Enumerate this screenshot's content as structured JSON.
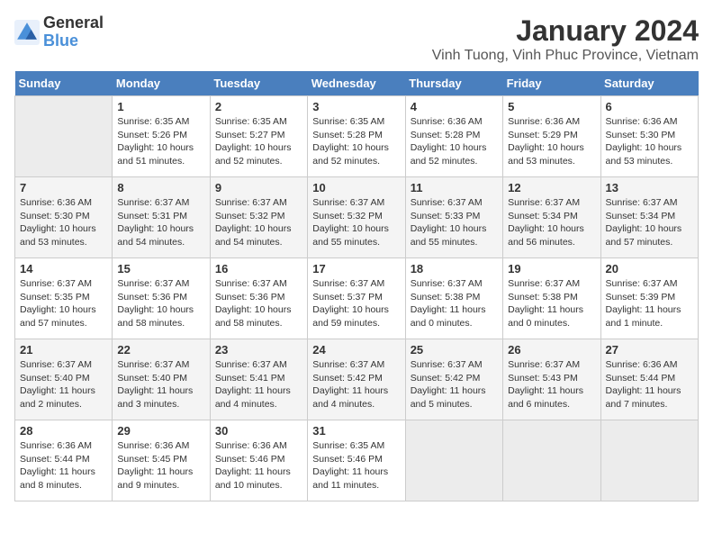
{
  "logo": {
    "text_general": "General",
    "text_blue": "Blue"
  },
  "title": "January 2024",
  "subtitle": "Vinh Tuong, Vinh Phuc Province, Vietnam",
  "header_days": [
    "Sunday",
    "Monday",
    "Tuesday",
    "Wednesday",
    "Thursday",
    "Friday",
    "Saturday"
  ],
  "weeks": [
    [
      {
        "day": "",
        "sunrise": "",
        "sunset": "",
        "daylight": ""
      },
      {
        "day": "1",
        "sunrise": "Sunrise: 6:35 AM",
        "sunset": "Sunset: 5:26 PM",
        "daylight": "Daylight: 10 hours and 51 minutes."
      },
      {
        "day": "2",
        "sunrise": "Sunrise: 6:35 AM",
        "sunset": "Sunset: 5:27 PM",
        "daylight": "Daylight: 10 hours and 52 minutes."
      },
      {
        "day": "3",
        "sunrise": "Sunrise: 6:35 AM",
        "sunset": "Sunset: 5:28 PM",
        "daylight": "Daylight: 10 hours and 52 minutes."
      },
      {
        "day": "4",
        "sunrise": "Sunrise: 6:36 AM",
        "sunset": "Sunset: 5:28 PM",
        "daylight": "Daylight: 10 hours and 52 minutes."
      },
      {
        "day": "5",
        "sunrise": "Sunrise: 6:36 AM",
        "sunset": "Sunset: 5:29 PM",
        "daylight": "Daylight: 10 hours and 53 minutes."
      },
      {
        "day": "6",
        "sunrise": "Sunrise: 6:36 AM",
        "sunset": "Sunset: 5:30 PM",
        "daylight": "Daylight: 10 hours and 53 minutes."
      }
    ],
    [
      {
        "day": "7",
        "sunrise": "Sunrise: 6:36 AM",
        "sunset": "Sunset: 5:30 PM",
        "daylight": "Daylight: 10 hours and 53 minutes."
      },
      {
        "day": "8",
        "sunrise": "Sunrise: 6:37 AM",
        "sunset": "Sunset: 5:31 PM",
        "daylight": "Daylight: 10 hours and 54 minutes."
      },
      {
        "day": "9",
        "sunrise": "Sunrise: 6:37 AM",
        "sunset": "Sunset: 5:32 PM",
        "daylight": "Daylight: 10 hours and 54 minutes."
      },
      {
        "day": "10",
        "sunrise": "Sunrise: 6:37 AM",
        "sunset": "Sunset: 5:32 PM",
        "daylight": "Daylight: 10 hours and 55 minutes."
      },
      {
        "day": "11",
        "sunrise": "Sunrise: 6:37 AM",
        "sunset": "Sunset: 5:33 PM",
        "daylight": "Daylight: 10 hours and 55 minutes."
      },
      {
        "day": "12",
        "sunrise": "Sunrise: 6:37 AM",
        "sunset": "Sunset: 5:34 PM",
        "daylight": "Daylight: 10 hours and 56 minutes."
      },
      {
        "day": "13",
        "sunrise": "Sunrise: 6:37 AM",
        "sunset": "Sunset: 5:34 PM",
        "daylight": "Daylight: 10 hours and 57 minutes."
      }
    ],
    [
      {
        "day": "14",
        "sunrise": "Sunrise: 6:37 AM",
        "sunset": "Sunset: 5:35 PM",
        "daylight": "Daylight: 10 hours and 57 minutes."
      },
      {
        "day": "15",
        "sunrise": "Sunrise: 6:37 AM",
        "sunset": "Sunset: 5:36 PM",
        "daylight": "Daylight: 10 hours and 58 minutes."
      },
      {
        "day": "16",
        "sunrise": "Sunrise: 6:37 AM",
        "sunset": "Sunset: 5:36 PM",
        "daylight": "Daylight: 10 hours and 58 minutes."
      },
      {
        "day": "17",
        "sunrise": "Sunrise: 6:37 AM",
        "sunset": "Sunset: 5:37 PM",
        "daylight": "Daylight: 10 hours and 59 minutes."
      },
      {
        "day": "18",
        "sunrise": "Sunrise: 6:37 AM",
        "sunset": "Sunset: 5:38 PM",
        "daylight": "Daylight: 11 hours and 0 minutes."
      },
      {
        "day": "19",
        "sunrise": "Sunrise: 6:37 AM",
        "sunset": "Sunset: 5:38 PM",
        "daylight": "Daylight: 11 hours and 0 minutes."
      },
      {
        "day": "20",
        "sunrise": "Sunrise: 6:37 AM",
        "sunset": "Sunset: 5:39 PM",
        "daylight": "Daylight: 11 hours and 1 minute."
      }
    ],
    [
      {
        "day": "21",
        "sunrise": "Sunrise: 6:37 AM",
        "sunset": "Sunset: 5:40 PM",
        "daylight": "Daylight: 11 hours and 2 minutes."
      },
      {
        "day": "22",
        "sunrise": "Sunrise: 6:37 AM",
        "sunset": "Sunset: 5:40 PM",
        "daylight": "Daylight: 11 hours and 3 minutes."
      },
      {
        "day": "23",
        "sunrise": "Sunrise: 6:37 AM",
        "sunset": "Sunset: 5:41 PM",
        "daylight": "Daylight: 11 hours and 4 minutes."
      },
      {
        "day": "24",
        "sunrise": "Sunrise: 6:37 AM",
        "sunset": "Sunset: 5:42 PM",
        "daylight": "Daylight: 11 hours and 4 minutes."
      },
      {
        "day": "25",
        "sunrise": "Sunrise: 6:37 AM",
        "sunset": "Sunset: 5:42 PM",
        "daylight": "Daylight: 11 hours and 5 minutes."
      },
      {
        "day": "26",
        "sunrise": "Sunrise: 6:37 AM",
        "sunset": "Sunset: 5:43 PM",
        "daylight": "Daylight: 11 hours and 6 minutes."
      },
      {
        "day": "27",
        "sunrise": "Sunrise: 6:36 AM",
        "sunset": "Sunset: 5:44 PM",
        "daylight": "Daylight: 11 hours and 7 minutes."
      }
    ],
    [
      {
        "day": "28",
        "sunrise": "Sunrise: 6:36 AM",
        "sunset": "Sunset: 5:44 PM",
        "daylight": "Daylight: 11 hours and 8 minutes."
      },
      {
        "day": "29",
        "sunrise": "Sunrise: 6:36 AM",
        "sunset": "Sunset: 5:45 PM",
        "daylight": "Daylight: 11 hours and 9 minutes."
      },
      {
        "day": "30",
        "sunrise": "Sunrise: 6:36 AM",
        "sunset": "Sunset: 5:46 PM",
        "daylight": "Daylight: 11 hours and 10 minutes."
      },
      {
        "day": "31",
        "sunrise": "Sunrise: 6:35 AM",
        "sunset": "Sunset: 5:46 PM",
        "daylight": "Daylight: 11 hours and 11 minutes."
      },
      {
        "day": "",
        "sunrise": "",
        "sunset": "",
        "daylight": ""
      },
      {
        "day": "",
        "sunrise": "",
        "sunset": "",
        "daylight": ""
      },
      {
        "day": "",
        "sunrise": "",
        "sunset": "",
        "daylight": ""
      }
    ]
  ]
}
